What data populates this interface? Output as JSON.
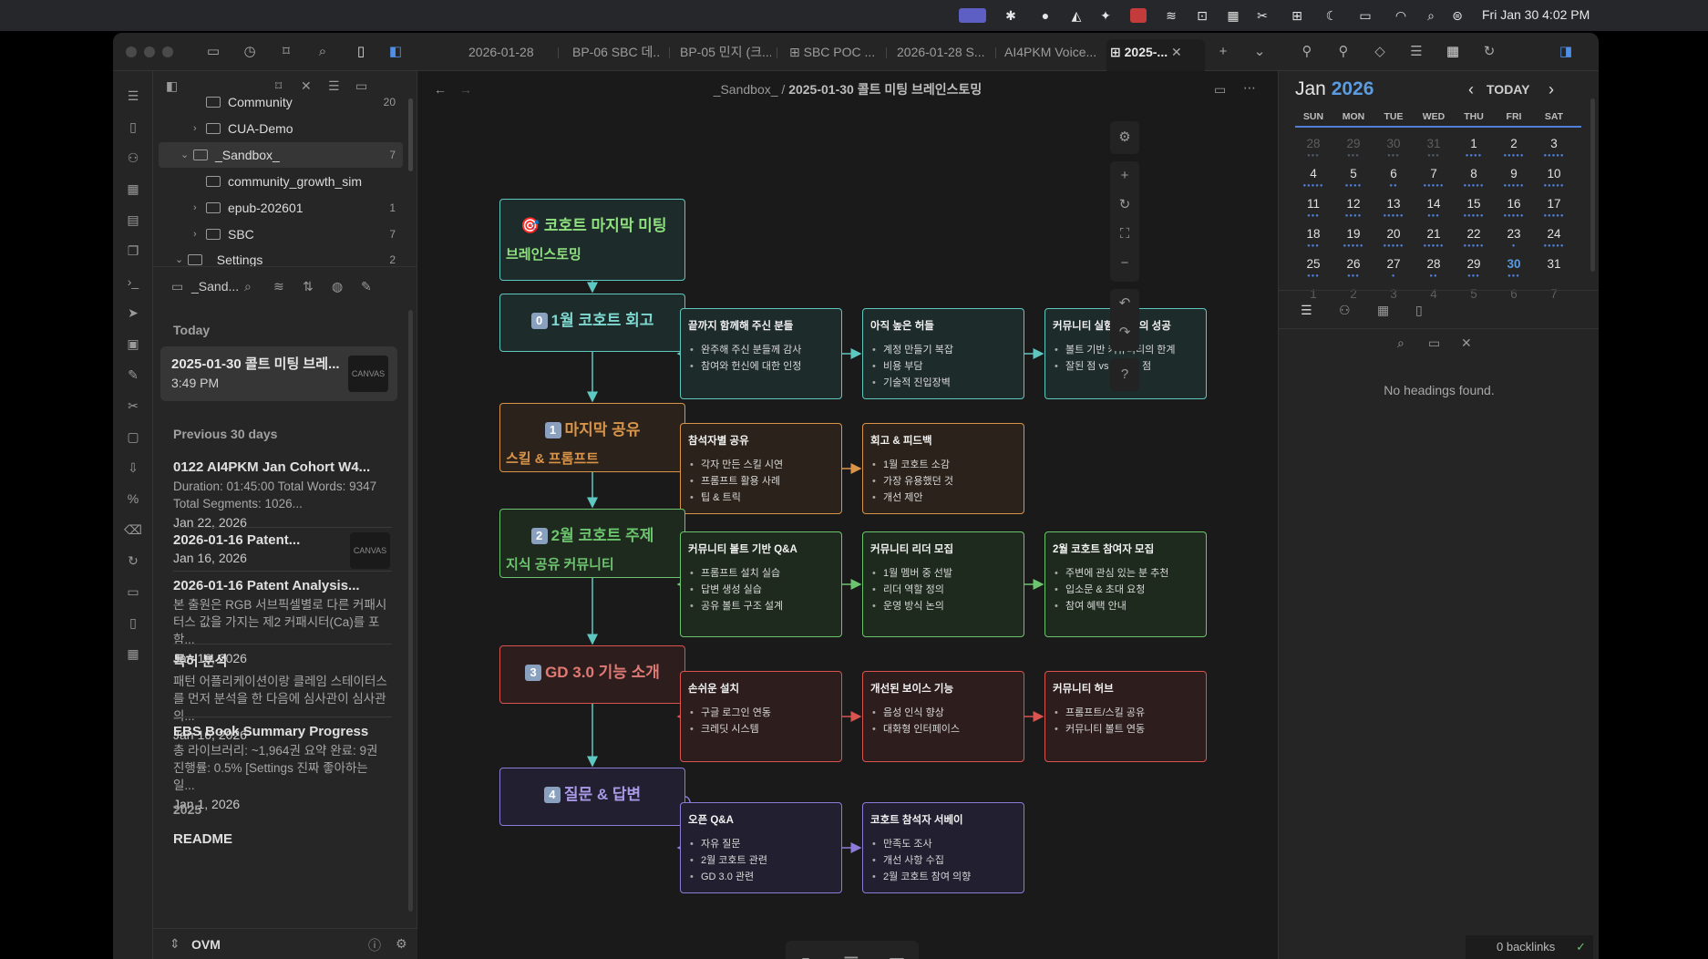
{
  "menubar": {
    "clock": "Fri Jan 30  4:02 PM"
  },
  "tabs": [
    {
      "label": "2026-01-28"
    },
    {
      "label": "BP-06 SBC 데..."
    },
    {
      "label": "BP-05 민지 (크..."
    },
    {
      "label": "SBC POC ..."
    },
    {
      "label": "2026-01-28 S..."
    },
    {
      "label": "AI4PKM Voice..."
    },
    {
      "label": "2025-..."
    }
  ],
  "tree": [
    {
      "label": "Community",
      "count": "20"
    },
    {
      "label": "CUA-Demo",
      "count": ""
    },
    {
      "label": "_Sandbox_",
      "count": "7"
    },
    {
      "label": "community_growth_sim",
      "count": ""
    },
    {
      "label": "epub-202601",
      "count": "1"
    },
    {
      "label": "SBC",
      "count": "7"
    },
    {
      "label": "_Settings_",
      "count": "2"
    }
  ],
  "notes_header": {
    "folder": "_Sand..."
  },
  "sections": {
    "today": "Today",
    "prev30": "Previous 30 days",
    "year": "2025"
  },
  "today_note": {
    "title": "2025-01-30 콜트 미팅 브레...",
    "time": "3:49 PM",
    "badge": "CANVAS"
  },
  "notes": [
    {
      "title": "0122 AI4PKM Jan Cohort W4...",
      "preview": "Duration: 01:45:00 Total Words: 9347 Total Segments: 1026...",
      "date": "Jan 22, 2026",
      "badge": ""
    },
    {
      "title": "2026-01-16 Patent...",
      "preview": "",
      "date": "Jan 16, 2026",
      "badge": "CANVAS"
    },
    {
      "title": "2026-01-16 Patent Analysis...",
      "preview": "본 출원은 RGB 서브픽셀별로 다른 커패시터스 값을 가지는 제2 커패시터(Ca)를 포함...",
      "date": "Jan 16, 2026",
      "badge": ""
    },
    {
      "title": "특허 분석",
      "preview": "패턴 어플리케이션이랑 클레임 스테이터스를 먼저 분석을 한 다음에 심사관이 심사관의...",
      "date": "Jan 16, 2026",
      "badge": ""
    },
    {
      "title": "EBS Book Summary Progress",
      "preview": "총 라이브러리: ~1,964권 요약 완료: 9권 진행률: 0.5% [Settings 진짜 좋아하는 일...",
      "date": "Jan 1, 2026",
      "badge": ""
    }
  ],
  "readme": "README",
  "vault": "OVM",
  "breadcrumb": {
    "folder": "_Sandbox_",
    "sep": "/",
    "file": "2025-01-30 콜트 미팅 브레인스토밍"
  },
  "canvas": {
    "top": {
      "title": "🎯 코호트 마지막 미팅",
      "sub": "브레인스토밍"
    },
    "main": [
      {
        "num": "0",
        "title": "1월 코호트 회고",
        "sub": ""
      },
      {
        "num": "1",
        "title": "마지막 공유",
        "sub": "스킬 & 프롬프트"
      },
      {
        "num": "2",
        "title": "2월 코호트 주제",
        "sub": "지식 공유 커뮤니티"
      },
      {
        "num": "3",
        "title": "GD 3.0 기능 소개",
        "sub": ""
      },
      {
        "num": "4",
        "title": "질문 & 답변",
        "sub": ""
      }
    ],
    "cards": [
      [
        {
          "h": "끝까지 함께해 주신 분들",
          "items": [
            "완주해 주신 분들께 감사",
            "참여와 헌신에 대한 인정"
          ]
        },
        {
          "h": "아직 높은 허들",
          "items": [
            "계정 만들기 복잡",
            "비용 부담",
            "기술적 진입장벽"
          ]
        },
        {
          "h": "커뮤니티 실험: 절반의 성공",
          "items": [
            "볼트 기반 커뮤니티의 한계",
            "잘된 점 vs 부족한 점"
          ]
        }
      ],
      [
        {
          "h": "참석자별 공유",
          "items": [
            "각자 만든 스킬 시연",
            "프롬프트 활용 사례",
            "팁 & 트릭"
          ]
        },
        {
          "h": "회고 & 피드백",
          "items": [
            "1월 코호트 소감",
            "가장 유용했던 것",
            "개선 제안"
          ]
        }
      ],
      [
        {
          "h": "커뮤니티 볼트 기반 Q&A",
          "items": [
            "프롬프트 설치 실습",
            "답변 생성 실습",
            "공유 볼트 구조 설계"
          ]
        },
        {
          "h": "커뮤니티 리더 모집",
          "items": [
            "1월 멤버 중 선발",
            "리더 역할 정의",
            "운영 방식 논의"
          ]
        },
        {
          "h": "2월 코호트 참여자 모집",
          "items": [
            "주변에 관심 있는 분 추천",
            "입소문 & 초대 요청",
            "참여 혜택 안내"
          ]
        }
      ],
      [
        {
          "h": "손쉬운 설치",
          "items": [
            "구글 로그인 연동",
            "크레딧 시스템"
          ]
        },
        {
          "h": "개선된 보이스 기능",
          "items": [
            "음성 인식 향상",
            "대화형 인터페이스"
          ]
        },
        {
          "h": "커뮤니티 허브",
          "items": [
            "프롬프트/스킬 공유",
            "커뮤니티 볼트 연동"
          ]
        }
      ],
      [
        {
          "h": "오픈 Q&A",
          "items": [
            "자유 질문",
            "2월 코호트 관련",
            "GD 3.0 관련"
          ]
        },
        {
          "h": "코호트 참석자 서베이",
          "items": [
            "만족도 조사",
            "개선 사항 수집",
            "2월 코호트 참여 의향"
          ]
        }
      ]
    ]
  },
  "colors": {
    "teal": "#5ec8c0",
    "teal_bg": "#1d2b2a",
    "orange": "#d9944a",
    "orange_bg": "#2b231b",
    "green": "#6cc46e",
    "green_bg": "#1e2a1e",
    "red": "#d9534f",
    "red_bg": "#2d1d1d",
    "purple": "#8e7ad9",
    "purple_bg": "#221f30",
    "top_title": "#8fe07e"
  },
  "calendar": {
    "month": "Jan",
    "year": "2026",
    "today_btn": "TODAY",
    "dow": [
      "SUN",
      "MON",
      "TUE",
      "WED",
      "THU",
      "FRI",
      "SAT"
    ],
    "weeks": [
      [
        "28",
        "29",
        "30",
        "31",
        "1",
        "2",
        "3"
      ],
      [
        "4",
        "5",
        "6",
        "7",
        "8",
        "9",
        "10"
      ],
      [
        "11",
        "12",
        "13",
        "14",
        "15",
        "16",
        "17"
      ],
      [
        "18",
        "19",
        "20",
        "21",
        "22",
        "23",
        "24"
      ],
      [
        "25",
        "26",
        "27",
        "28",
        "29",
        "30",
        "31"
      ],
      [
        "1",
        "2",
        "3",
        "4",
        "5",
        "6",
        "7"
      ]
    ]
  },
  "outline": {
    "empty": "No headings found."
  },
  "backlinks": "0 backlinks"
}
